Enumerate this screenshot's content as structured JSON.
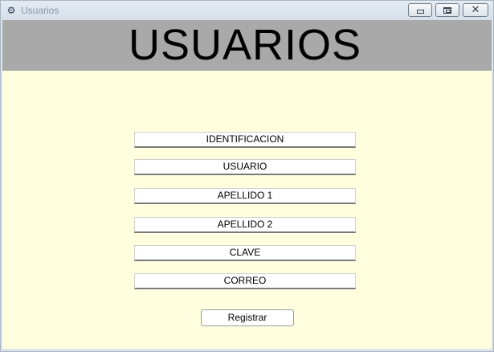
{
  "window": {
    "title": "Usuarios",
    "app_icon": "app-icon",
    "controls": {
      "minimize_icon": "minimize-icon",
      "maximize_icon": "maximize-icon",
      "close_glyph": "✕"
    }
  },
  "header": {
    "title": "USUARIOS",
    "background": "#a9a9a9"
  },
  "form": {
    "background": "#ffffe0",
    "fields": [
      {
        "label": "IDENTIFICACION"
      },
      {
        "label": "USUARIO"
      },
      {
        "label": "APELLIDO 1"
      },
      {
        "label": "APELLIDO 2"
      },
      {
        "label": "CLAVE"
      },
      {
        "label": "CORREO"
      }
    ],
    "submit_label": "Registrar"
  }
}
